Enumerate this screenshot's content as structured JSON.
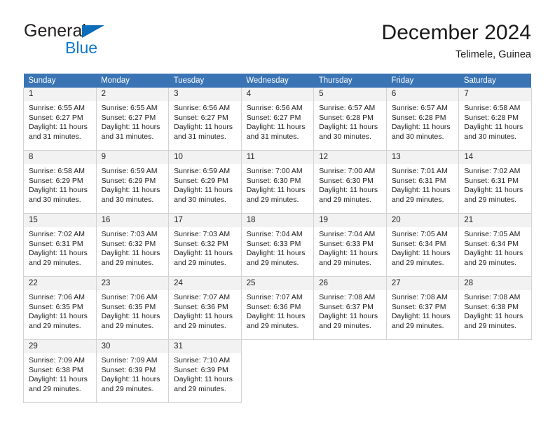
{
  "brand": {
    "name_top": "General",
    "name_bottom": "Blue",
    "triangle_icon": "triangle-icon",
    "color_top": "#231f20",
    "color_bottom": "#1178c8",
    "triangle_color": "#0b6cb7"
  },
  "header": {
    "title": "December 2024",
    "subtitle": "Telimele, Guinea"
  },
  "theme": {
    "header_row_bg": "#3a74b4",
    "header_row_text": "#ffffff",
    "daynum_bg": "#f2f2f2",
    "cell_border": "#d3d3d3",
    "body_text": "#222222"
  },
  "calendar": {
    "weekdays": [
      "Sunday",
      "Monday",
      "Tuesday",
      "Wednesday",
      "Thursday",
      "Friday",
      "Saturday"
    ],
    "weeks": [
      [
        {
          "day": "1",
          "sunrise": "Sunrise: 6:55 AM",
          "sunset": "Sunset: 6:27 PM",
          "daylight_1": "Daylight: 11 hours",
          "daylight_2": "and 31 minutes."
        },
        {
          "day": "2",
          "sunrise": "Sunrise: 6:55 AM",
          "sunset": "Sunset: 6:27 PM",
          "daylight_1": "Daylight: 11 hours",
          "daylight_2": "and 31 minutes."
        },
        {
          "day": "3",
          "sunrise": "Sunrise: 6:56 AM",
          "sunset": "Sunset: 6:27 PM",
          "daylight_1": "Daylight: 11 hours",
          "daylight_2": "and 31 minutes."
        },
        {
          "day": "4",
          "sunrise": "Sunrise: 6:56 AM",
          "sunset": "Sunset: 6:27 PM",
          "daylight_1": "Daylight: 11 hours",
          "daylight_2": "and 31 minutes."
        },
        {
          "day": "5",
          "sunrise": "Sunrise: 6:57 AM",
          "sunset": "Sunset: 6:28 PM",
          "daylight_1": "Daylight: 11 hours",
          "daylight_2": "and 30 minutes."
        },
        {
          "day": "6",
          "sunrise": "Sunrise: 6:57 AM",
          "sunset": "Sunset: 6:28 PM",
          "daylight_1": "Daylight: 11 hours",
          "daylight_2": "and 30 minutes."
        },
        {
          "day": "7",
          "sunrise": "Sunrise: 6:58 AM",
          "sunset": "Sunset: 6:28 PM",
          "daylight_1": "Daylight: 11 hours",
          "daylight_2": "and 30 minutes."
        }
      ],
      [
        {
          "day": "8",
          "sunrise": "Sunrise: 6:58 AM",
          "sunset": "Sunset: 6:29 PM",
          "daylight_1": "Daylight: 11 hours",
          "daylight_2": "and 30 minutes."
        },
        {
          "day": "9",
          "sunrise": "Sunrise: 6:59 AM",
          "sunset": "Sunset: 6:29 PM",
          "daylight_1": "Daylight: 11 hours",
          "daylight_2": "and 30 minutes."
        },
        {
          "day": "10",
          "sunrise": "Sunrise: 6:59 AM",
          "sunset": "Sunset: 6:29 PM",
          "daylight_1": "Daylight: 11 hours",
          "daylight_2": "and 30 minutes."
        },
        {
          "day": "11",
          "sunrise": "Sunrise: 7:00 AM",
          "sunset": "Sunset: 6:30 PM",
          "daylight_1": "Daylight: 11 hours",
          "daylight_2": "and 29 minutes."
        },
        {
          "day": "12",
          "sunrise": "Sunrise: 7:00 AM",
          "sunset": "Sunset: 6:30 PM",
          "daylight_1": "Daylight: 11 hours",
          "daylight_2": "and 29 minutes."
        },
        {
          "day": "13",
          "sunrise": "Sunrise: 7:01 AM",
          "sunset": "Sunset: 6:31 PM",
          "daylight_1": "Daylight: 11 hours",
          "daylight_2": "and 29 minutes."
        },
        {
          "day": "14",
          "sunrise": "Sunrise: 7:02 AM",
          "sunset": "Sunset: 6:31 PM",
          "daylight_1": "Daylight: 11 hours",
          "daylight_2": "and 29 minutes."
        }
      ],
      [
        {
          "day": "15",
          "sunrise": "Sunrise: 7:02 AM",
          "sunset": "Sunset: 6:31 PM",
          "daylight_1": "Daylight: 11 hours",
          "daylight_2": "and 29 minutes."
        },
        {
          "day": "16",
          "sunrise": "Sunrise: 7:03 AM",
          "sunset": "Sunset: 6:32 PM",
          "daylight_1": "Daylight: 11 hours",
          "daylight_2": "and 29 minutes."
        },
        {
          "day": "17",
          "sunrise": "Sunrise: 7:03 AM",
          "sunset": "Sunset: 6:32 PM",
          "daylight_1": "Daylight: 11 hours",
          "daylight_2": "and 29 minutes."
        },
        {
          "day": "18",
          "sunrise": "Sunrise: 7:04 AM",
          "sunset": "Sunset: 6:33 PM",
          "daylight_1": "Daylight: 11 hours",
          "daylight_2": "and 29 minutes."
        },
        {
          "day": "19",
          "sunrise": "Sunrise: 7:04 AM",
          "sunset": "Sunset: 6:33 PM",
          "daylight_1": "Daylight: 11 hours",
          "daylight_2": "and 29 minutes."
        },
        {
          "day": "20",
          "sunrise": "Sunrise: 7:05 AM",
          "sunset": "Sunset: 6:34 PM",
          "daylight_1": "Daylight: 11 hours",
          "daylight_2": "and 29 minutes."
        },
        {
          "day": "21",
          "sunrise": "Sunrise: 7:05 AM",
          "sunset": "Sunset: 6:34 PM",
          "daylight_1": "Daylight: 11 hours",
          "daylight_2": "and 29 minutes."
        }
      ],
      [
        {
          "day": "22",
          "sunrise": "Sunrise: 7:06 AM",
          "sunset": "Sunset: 6:35 PM",
          "daylight_1": "Daylight: 11 hours",
          "daylight_2": "and 29 minutes."
        },
        {
          "day": "23",
          "sunrise": "Sunrise: 7:06 AM",
          "sunset": "Sunset: 6:35 PM",
          "daylight_1": "Daylight: 11 hours",
          "daylight_2": "and 29 minutes."
        },
        {
          "day": "24",
          "sunrise": "Sunrise: 7:07 AM",
          "sunset": "Sunset: 6:36 PM",
          "daylight_1": "Daylight: 11 hours",
          "daylight_2": "and 29 minutes."
        },
        {
          "day": "25",
          "sunrise": "Sunrise: 7:07 AM",
          "sunset": "Sunset: 6:36 PM",
          "daylight_1": "Daylight: 11 hours",
          "daylight_2": "and 29 minutes."
        },
        {
          "day": "26",
          "sunrise": "Sunrise: 7:08 AM",
          "sunset": "Sunset: 6:37 PM",
          "daylight_1": "Daylight: 11 hours",
          "daylight_2": "and 29 minutes."
        },
        {
          "day": "27",
          "sunrise": "Sunrise: 7:08 AM",
          "sunset": "Sunset: 6:37 PM",
          "daylight_1": "Daylight: 11 hours",
          "daylight_2": "and 29 minutes."
        },
        {
          "day": "28",
          "sunrise": "Sunrise: 7:08 AM",
          "sunset": "Sunset: 6:38 PM",
          "daylight_1": "Daylight: 11 hours",
          "daylight_2": "and 29 minutes."
        }
      ],
      [
        {
          "day": "29",
          "sunrise": "Sunrise: 7:09 AM",
          "sunset": "Sunset: 6:38 PM",
          "daylight_1": "Daylight: 11 hours",
          "daylight_2": "and 29 minutes."
        },
        {
          "day": "30",
          "sunrise": "Sunrise: 7:09 AM",
          "sunset": "Sunset: 6:39 PM",
          "daylight_1": "Daylight: 11 hours",
          "daylight_2": "and 29 minutes."
        },
        {
          "day": "31",
          "sunrise": "Sunrise: 7:10 AM",
          "sunset": "Sunset: 6:39 PM",
          "daylight_1": "Daylight: 11 hours",
          "daylight_2": "and 29 minutes."
        },
        null,
        null,
        null,
        null
      ]
    ]
  }
}
